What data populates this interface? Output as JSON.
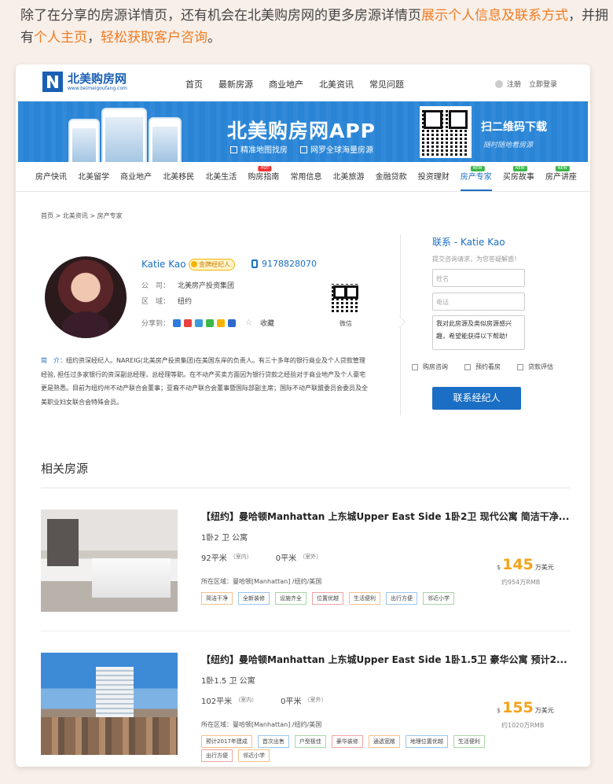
{
  "intro": {
    "p1": "除了在分享的房源详情页，还有机会在北美购房网的更多房源详情页",
    "h1": "展示个人信息及联系方式",
    "p2": "，并拥有",
    "h2": "个人主页",
    "p3": "，",
    "h3": "轻松获取客户咨询",
    "p4": "。"
  },
  "site": {
    "logo_cn": "北美购房网",
    "logo_url": "www.beimeigoufang.com",
    "nav": [
      "首页",
      "最新房源",
      "商业地产",
      "北美资讯",
      "常见问题"
    ],
    "register": "注册",
    "login": "立即登录"
  },
  "banner": {
    "title": "北美购房网APP",
    "feature1": "精准地图找房",
    "feature2": "网罗全球海量房源",
    "scan": "扫二维码下载",
    "scan_sub": "随时随地看房源"
  },
  "categories": [
    {
      "label": "房产快讯",
      "tag": ""
    },
    {
      "label": "北美留学",
      "tag": ""
    },
    {
      "label": "商业地产",
      "tag": ""
    },
    {
      "label": "北美移民",
      "tag": ""
    },
    {
      "label": "北美生活",
      "tag": ""
    },
    {
      "label": "购房指南",
      "tag": "HOT"
    },
    {
      "label": "常用信息",
      "tag": ""
    },
    {
      "label": "北美旅游",
      "tag": ""
    },
    {
      "label": "金融贷款",
      "tag": ""
    },
    {
      "label": "投资理财",
      "tag": ""
    },
    {
      "label": "房产专家",
      "tag": "NEW",
      "active": true
    },
    {
      "label": "买房故事",
      "tag": "NEW"
    },
    {
      "label": "房产讲座",
      "tag": "NEW"
    }
  ],
  "breadcrumb": "首页 > 北美资讯 > 房产专家",
  "agent": {
    "name": "Katie Kao",
    "badge": "金牌经纪人",
    "phone": "9178828070",
    "company_label": "公　司：",
    "company": "北美房产投资集团",
    "region_label": "区　域：",
    "region": "纽约",
    "share_label": "分享到：",
    "favorite": "收藏",
    "wechat": "微信",
    "bio_label": "简　介：",
    "bio": "纽约资深经纪人。NAREIG(北美房产投资集团)在美国东岸的负责人。有三十多年的银行商业及个人贷款管理经验, 担任过多家银行的资深副总经理，总经理等职。在不动产买卖方面因为银行贷款之经验对于商业地产及个人豪宅更是熟悉。目前为纽约州不动产联合会董事；亚裔不动产联合会董事暨国际部副主席；国际不动产联盟委员会委员及全美职业妇女联合会特殊会员。"
  },
  "contact": {
    "title": "联系 - Katie Kao",
    "sub": "提交咨询请求，为您答疑解惑！",
    "name_ph": "姓名",
    "phone_ph": "电话",
    "message": "我对此房源及类似房源感兴趣，希望能获得以下帮助!",
    "opt1": "购房咨询",
    "opt2": "预约看房",
    "opt3": "贷款评估",
    "button": "联系经纪人"
  },
  "related": {
    "title": "相关房源",
    "listings": [
      {
        "title": "【纽约】曼哈顿Manhattan 上东城Upper East Side 1卧2卫 现代公寓 简洁干净...",
        "rooms": "1卧2 卫 公寓",
        "indoor": "92平米",
        "indoor_label": "（室内）",
        "outdoor": "0平米",
        "outdoor_label": "（室外）",
        "location": "所在区域：曼哈顿[Manhattan] /纽约/美国",
        "tags": [
          "简洁干净",
          "全新装修",
          "设施齐全",
          "位置优越",
          "生活便利",
          "出行方便",
          "邻近小学"
        ],
        "currency": "$",
        "price": "145",
        "price_unit": "万美元",
        "rmb": "约954万RMB"
      },
      {
        "title": "【纽约】曼哈顿Manhattan 上东城Upper East Side 1卧1.5卫 豪华公寓 预计2...",
        "rooms": "1卧1.5 卫 公寓",
        "indoor": "102平米",
        "indoor_label": "（室内）",
        "outdoor": "0平米",
        "outdoor_label": "（室外）",
        "location": "所在区域：曼哈顿[Manhattan] /纽约/美国",
        "tags": [
          "预计2017年建成",
          "首次出售",
          "户型极佳",
          "豪华装修",
          "通透宽敞",
          "地理位置优越",
          "生活便利",
          "出行方便",
          "邻近小学"
        ],
        "currency": "$",
        "price": "155",
        "price_unit": "万美元",
        "rmb": "约1020万RMB"
      }
    ]
  },
  "colors": {
    "accent": "#1a6fc4",
    "highlight": "#f07b1f",
    "price": "#f5a21b",
    "banner": "#2a85d6"
  }
}
